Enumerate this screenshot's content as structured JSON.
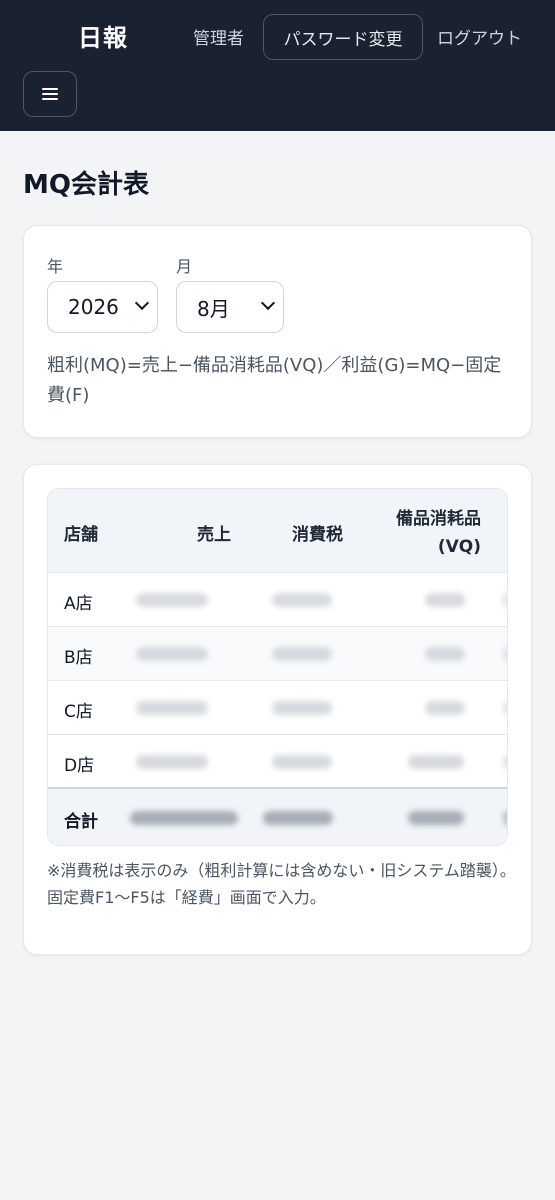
{
  "nav": {
    "brand": "日報",
    "user": "管理者",
    "password_change": "パスワード変更",
    "logout": "ログアウト"
  },
  "page": {
    "title": "MQ会計表"
  },
  "filters": {
    "year_label": "年",
    "year_value": "2026",
    "month_label": "月",
    "month_value": "8月",
    "formula": "粗利(MQ)=売上−備品消耗品(VQ)／利益(G)=MQ−固定費(F)"
  },
  "table": {
    "headers": [
      "店舗",
      "売上",
      "消費税",
      "備品消耗品(VQ)"
    ],
    "rows": [
      {
        "store": "A店"
      },
      {
        "store": "B店"
      },
      {
        "store": "C店"
      },
      {
        "store": "D店"
      }
    ],
    "total_label": "合計"
  },
  "note": "※消費税は表示のみ（粗利計算には含めない・旧システム踏襲）。固定費F1〜F5は「経費」画面で入力。"
}
